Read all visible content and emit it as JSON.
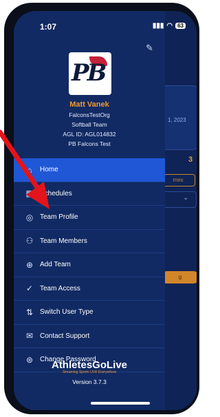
{
  "status_bar": {
    "time": "1:07",
    "battery": "63"
  },
  "background": {
    "date_text": "1, 2023",
    "count": "3",
    "pill_label": "mes",
    "button_label": "g"
  },
  "drawer": {
    "profile": {
      "name": "Matt Vanek",
      "org": "FalconsTestOrg",
      "team": "Softball Team",
      "agl_id": "AGL ID: AGL014832",
      "team_name": "PB Falcons Test"
    },
    "logo_text": "PB",
    "menu": [
      {
        "label": "Home",
        "icon": "home-icon",
        "glyph": "⌂"
      },
      {
        "label": "Schedules",
        "icon": "calendar-icon",
        "glyph": "▦"
      },
      {
        "label": "Team Profile",
        "icon": "shield-icon",
        "glyph": "◎"
      },
      {
        "label": "Team Members",
        "icon": "members-icon",
        "glyph": "⚇"
      },
      {
        "label": "Add Team",
        "icon": "add-team-icon",
        "glyph": "⊕"
      },
      {
        "label": "Team Access",
        "icon": "check-circle-icon",
        "glyph": "✓"
      },
      {
        "label": "Switch User Type",
        "icon": "switch-icon",
        "glyph": "⇅"
      },
      {
        "label": "Contact Support",
        "icon": "mail-icon",
        "glyph": "✉"
      },
      {
        "label": "Change Password",
        "icon": "key-icon",
        "glyph": "⊛"
      }
    ],
    "footer": {
      "brand": "AthletesGoLive",
      "tagline": "Streaming Sports LIVE Everywhere",
      "version": "Version 3.7.3"
    }
  },
  "colors": {
    "drawer_bg": "#112a63",
    "active_item": "#1f57d6",
    "accent": "#f29a2e",
    "arrow": "#e3141b"
  }
}
